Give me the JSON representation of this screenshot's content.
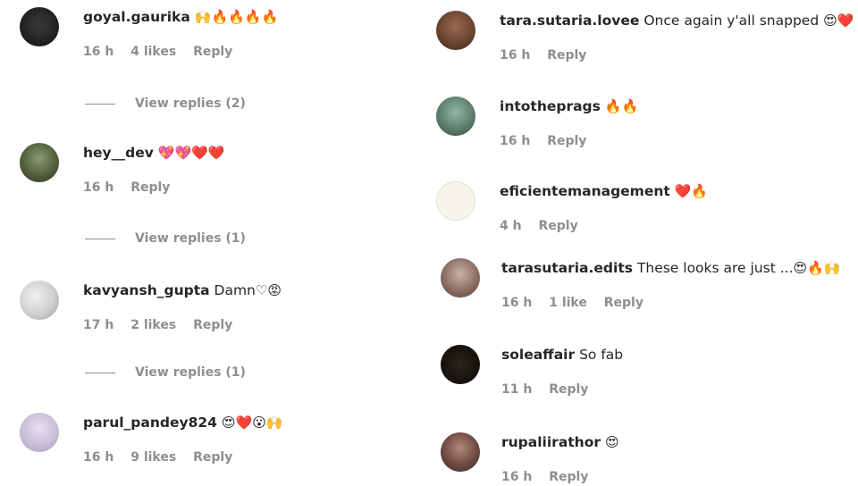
{
  "colors": {
    "text": "#262626",
    "meta": "#8e8e8e",
    "background": "#ffffff"
  },
  "left_comments": [
    {
      "username": "goyal.gaurika",
      "text": "",
      "emoji": "🙌🔥🔥🔥🔥",
      "time": "16 h",
      "likes": "4 likes",
      "reply": "Reply",
      "view_replies": "View replies (2)"
    },
    {
      "username": "hey__dev",
      "text": "",
      "emoji": "💖💖❤️❤️",
      "time": "16 h",
      "likes": "",
      "reply": "Reply",
      "view_replies": "View replies (1)"
    },
    {
      "username": "kavyansh_gupta",
      "text": "Damn",
      "emoji": "♡😡",
      "time": "17 h",
      "likes": "2 likes",
      "reply": "Reply",
      "view_replies": "View replies (1)"
    },
    {
      "username": "parul_pandey824",
      "text": "",
      "emoji": "😍❤️😮🙌",
      "time": "16 h",
      "likes": "9 likes",
      "reply": "Reply",
      "view_replies": ""
    }
  ],
  "right_comments": [
    {
      "username": "tara.sutaria.lovee",
      "text": "Once again y'all snapped",
      "emoji": "😍❤️",
      "time": "16 h",
      "likes": "",
      "reply": "Reply"
    },
    {
      "username": "intotheprags",
      "text": "",
      "emoji": "🔥🔥",
      "time": "16 h",
      "likes": "",
      "reply": "Reply"
    },
    {
      "username": "eficientemanagement",
      "text": "",
      "emoji": "❤️🔥",
      "time": "4 h",
      "likes": "",
      "reply": "Reply"
    },
    {
      "username": "tarasutaria.edits",
      "text": "These looks are just ...",
      "emoji": "😍🔥🙌",
      "time": "16 h",
      "likes": "1 like",
      "reply": "Reply"
    },
    {
      "username": "soleaffair",
      "text": "So fab",
      "emoji": "",
      "time": "11 h",
      "likes": "",
      "reply": "Reply"
    },
    {
      "username": "rupaliirathor",
      "text": "",
      "emoji": "😍",
      "time": "16 h",
      "likes": "",
      "reply": "Reply"
    }
  ]
}
